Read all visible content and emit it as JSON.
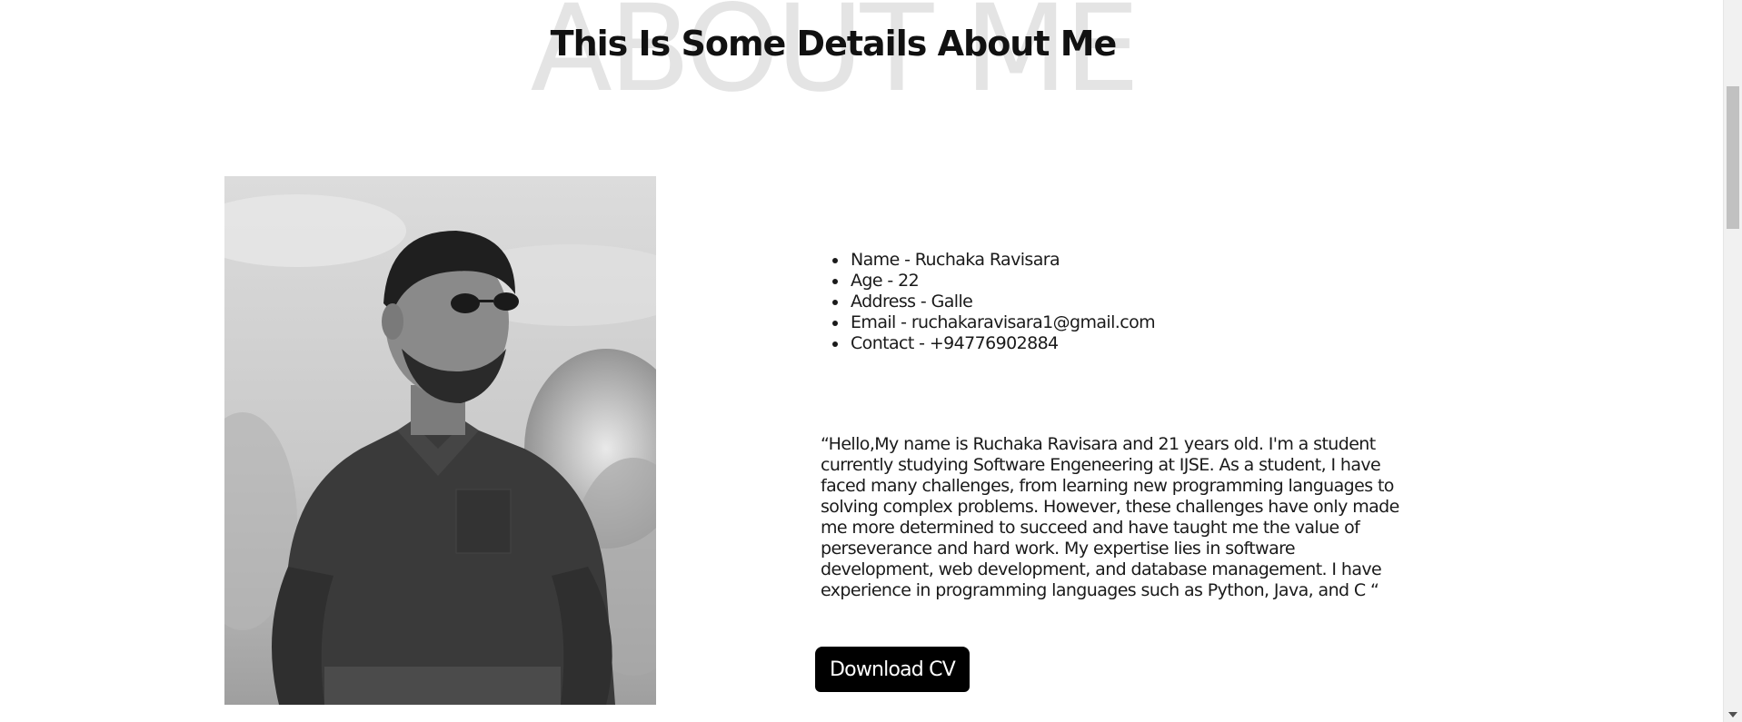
{
  "section": {
    "background_title": "ABOUT ME",
    "title": "This Is Some Details About Me"
  },
  "photo": {
    "description_icon": "portrait-photo"
  },
  "details": {
    "items": [
      "Name - Ruchaka Ravisara",
      "Age - 22",
      "Address - Galle",
      "Email - ruchakaravisara1@gmail.com",
      "Contact - +94776902884"
    ]
  },
  "bio": {
    "text": "“Hello,My name is Ruchaka Ravisara and 21 years old. I'm a student currently studying Software Engeneering at IJSE. As a student, I have faced many challenges, from learning new programming languages to solving complex problems. However, these challenges have only made me more determined to succeed and have taught me the value of perseverance and hard work. My expertise lies in software development, web development, and database management. I have experience in programming languages such as Python, Java, and C “"
  },
  "cv_button": {
    "label": "Download CV"
  },
  "colors": {
    "background": "#ffffff",
    "button_bg": "#000000",
    "button_text": "#ffffff",
    "ghost_title": "#e4e4e4"
  }
}
